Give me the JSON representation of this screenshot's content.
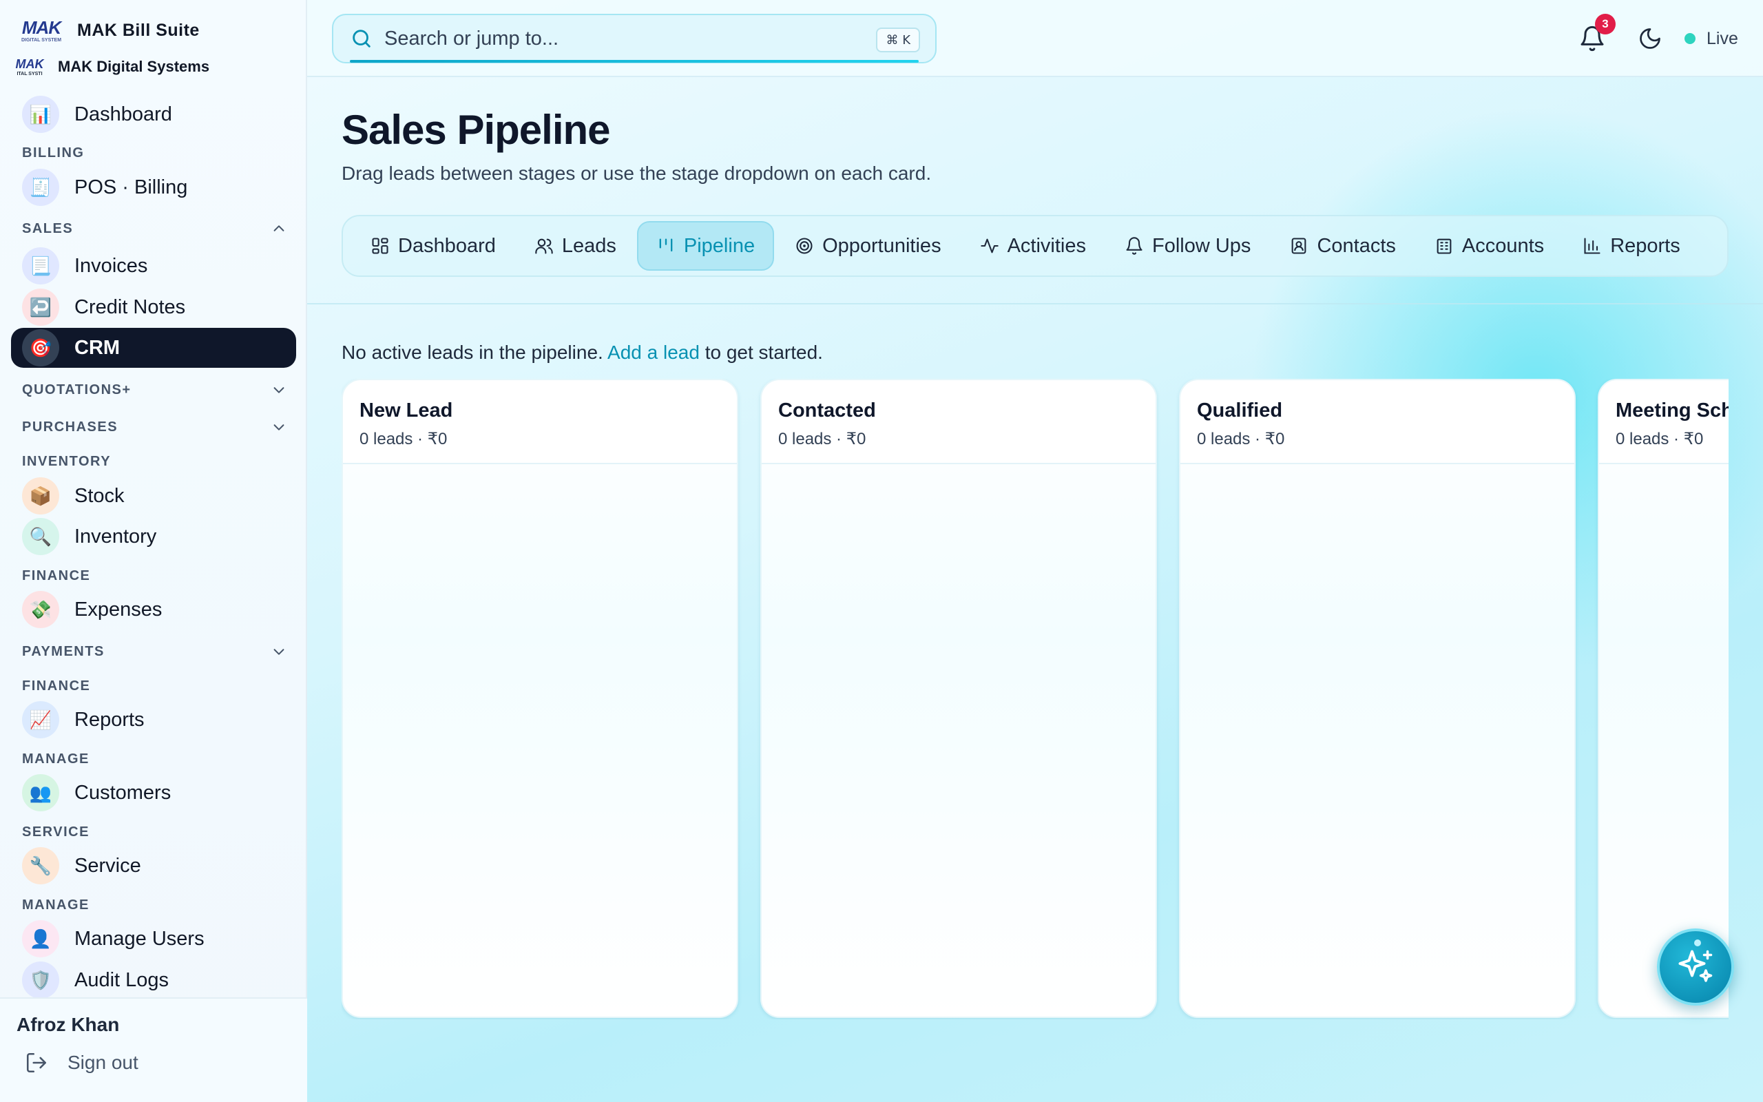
{
  "sidebar": {
    "brand_logo": "MAK",
    "brand_logo_sub": "DIGITAL SYSTEM",
    "brand_title": "MAK Bill Suite",
    "org_logo": "MAK",
    "org_logo_sub": "ITAL SYSTI",
    "org_name": "MAK Digital Systems",
    "sections": {
      "billing": "BILLING",
      "sales": "SALES",
      "quotations": "QUOTATIONS+",
      "purchases": "PURCHASES",
      "inventory": "INVENTORY",
      "finance1": "FINANCE",
      "payments": "PAYMENTS",
      "finance2": "FINANCE",
      "manage1": "MANAGE",
      "service": "SERVICE",
      "manage2": "MANAGE"
    },
    "items": {
      "dashboard": {
        "label": "Dashboard",
        "icon": "bar-chart-icon"
      },
      "pos_billing": {
        "label": "POS · Billing",
        "icon": "cash-register-icon"
      },
      "invoices": {
        "label": "Invoices",
        "icon": "receipt-icon"
      },
      "credit_notes": {
        "label": "Credit Notes",
        "icon": "return-arrow-icon"
      },
      "crm": {
        "label": "CRM",
        "icon": "target-icon"
      },
      "stock": {
        "label": "Stock",
        "icon": "package-icon"
      },
      "inventory": {
        "label": "Inventory",
        "icon": "magnifier-icon"
      },
      "expenses": {
        "label": "Expenses",
        "icon": "money-icon"
      },
      "reports": {
        "label": "Reports",
        "icon": "trend-chart-icon"
      },
      "customers": {
        "label": "Customers",
        "icon": "people-icon"
      },
      "service": {
        "label": "Service",
        "icon": "wrench-icon"
      },
      "manage_users": {
        "label": "Manage Users",
        "icon": "user-icon"
      },
      "audit_logs": {
        "label": "Audit Logs",
        "icon": "shield-icon"
      }
    },
    "user_name": "Afroz Khan",
    "sign_out": "Sign out"
  },
  "topbar": {
    "search_placeholder": "Search or jump to...",
    "shortcut": "⌘ K",
    "notification_count": "3",
    "status": "Live"
  },
  "page": {
    "title": "Sales Pipeline",
    "subtitle": "Drag leads between stages or use the stage dropdown on each card.",
    "empty_prefix": "No active leads in the pipeline. ",
    "empty_link": "Add a lead",
    "empty_suffix": " to get started."
  },
  "tabs": [
    {
      "label": "Dashboard",
      "icon": "grid-icon",
      "active": false
    },
    {
      "label": "Leads",
      "icon": "users-icon",
      "active": false
    },
    {
      "label": "Pipeline",
      "icon": "kanban-icon",
      "active": true
    },
    {
      "label": "Opportunities",
      "icon": "target-icon",
      "active": false
    },
    {
      "label": "Activities",
      "icon": "pulse-icon",
      "active": false
    },
    {
      "label": "Follow Ups",
      "icon": "bell-icon",
      "active": false
    },
    {
      "label": "Contacts",
      "icon": "contact-card-icon",
      "active": false
    },
    {
      "label": "Accounts",
      "icon": "building-icon",
      "active": false
    },
    {
      "label": "Reports",
      "icon": "bar-chart-icon",
      "active": false
    }
  ],
  "columns": [
    {
      "title": "New Lead",
      "meta": "0 leads · ₹0"
    },
    {
      "title": "Contacted",
      "meta": "0 leads · ₹0"
    },
    {
      "title": "Qualified",
      "meta": "0 leads · ₹0"
    },
    {
      "title": "Meeting Sch",
      "meta": "0 leads · ₹0"
    }
  ],
  "colors": {
    "accent": "#0891b2",
    "active_nav": "#0f172a",
    "badge": "#e11d48",
    "live": "#2dd4bf"
  }
}
